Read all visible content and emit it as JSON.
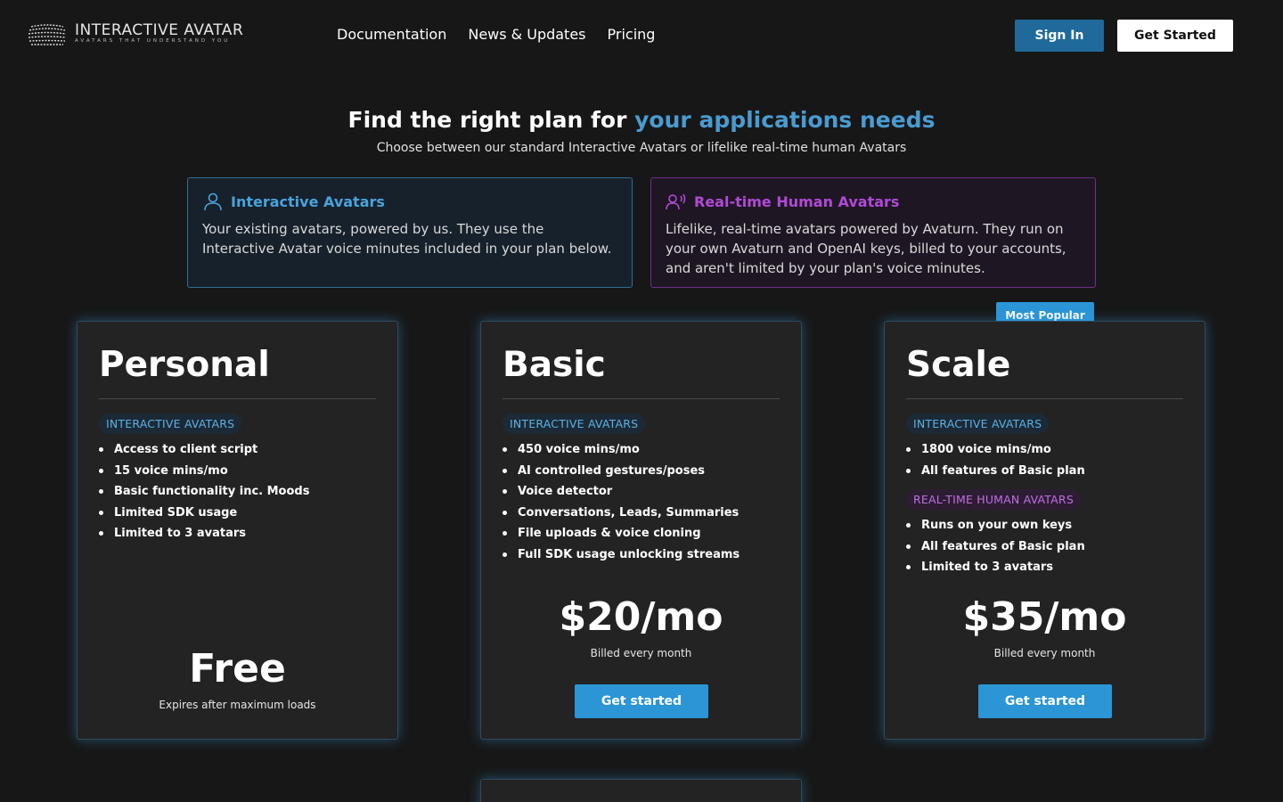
{
  "header": {
    "logo_title": "INTERACTIVE AVATAR",
    "logo_tagline": "AVATARS THAT UNDERSTAND YOU",
    "nav": [
      {
        "label": "Documentation"
      },
      {
        "label": "News & Updates"
      },
      {
        "label": "Pricing"
      }
    ],
    "sign_in_label": "Sign In",
    "get_started_label": "Get Started"
  },
  "hero": {
    "title_prefix": "Find the right plan for",
    "title_accent": "your applications needs",
    "subtitle": "Choose between our standard Interactive Avatars or lifelike real-time human Avatars"
  },
  "avatar_types": {
    "interactive": {
      "icon": "user-icon",
      "label": "Interactive Avatars",
      "description": "Your existing avatars, powered by us. They use the Interactive Avatar voice minutes included in your plan below."
    },
    "realtime": {
      "icon": "voice-user-icon",
      "label": "Real-time Human Avatars",
      "description": "Lifelike, real-time avatars powered by Avaturn. They run on your own Avaturn and OpenAI keys, billed to your accounts, and aren't limited by your plan's voice minutes."
    }
  },
  "colors": {
    "accent_blue": "#4a9bd1",
    "accent_purple": "#b04ad6",
    "button_blue": "#2b95d6",
    "background": "#171717"
  },
  "plans": {
    "personal": {
      "name": "Personal",
      "ia_tag": "INTERACTIVE AVATARS",
      "ia_features": [
        "Access to client script",
        "15 voice mins/mo",
        "Basic functionality inc. Moods",
        "Limited SDK usage",
        "Limited to 3 avatars"
      ],
      "price": "Free",
      "price_note": "Expires after maximum loads"
    },
    "basic": {
      "name": "Basic",
      "ia_tag": "INTERACTIVE AVATARS",
      "ia_features": [
        "450 voice mins/mo",
        "AI controlled gestures/poses",
        "Voice detector",
        "Conversations, Leads, Summaries",
        "File uploads & voice cloning",
        "Full SDK usage unlocking streams"
      ],
      "price": "$20/mo",
      "price_note": "Billed every month",
      "cta": "Get started"
    },
    "scale": {
      "badge": "Most Popular",
      "name": "Scale",
      "ia_tag": "INTERACTIVE AVATARS",
      "ia_features": [
        "1800 voice mins/mo",
        "All features of Basic plan"
      ],
      "rt_tag": "REAL-TIME HUMAN AVATARS",
      "rt_features": [
        "Runs on your own keys",
        "All features of Basic plan",
        "Limited to 3 avatars"
      ],
      "price": "$35/mo",
      "price_note": "Billed every month",
      "cta": "Get started"
    }
  }
}
